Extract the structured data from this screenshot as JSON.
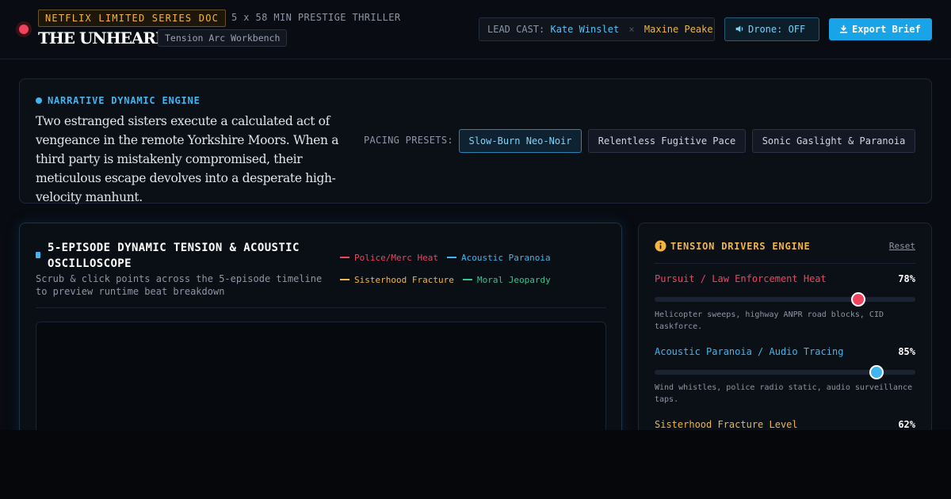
{
  "header": {
    "series_badge": "NETFLIX LIMITED SERIES DOC",
    "series_meta": "5 x 58 MIN PRESTIGE THRILLER",
    "title": "THE UNHEARD",
    "workbench_tag": "Tension Arc Workbench",
    "lead_cast_label": "LEAD CAST:",
    "lead_cast_1": "Kate Winslet",
    "lead_cast_sep": "×",
    "lead_cast_2": "Maxine Peake",
    "drone_label": "Drone: OFF",
    "export_label": "Export Brief"
  },
  "narrative": {
    "label": "NARRATIVE DYNAMIC ENGINE",
    "synopsis": "Two estranged sisters execute a calculated act of vengeance in the remote Yorkshire Moors. When a third party is mistakenly compromised, their meticulous escape devolves into a desperate high-velocity manhunt.",
    "presets_label": "PACING PRESETS:",
    "presets": [
      {
        "label": "Slow-Burn Neo-Noir",
        "active": true
      },
      {
        "label": "Relentless Fugitive Pace",
        "active": false
      },
      {
        "label": "Sonic Gaslight & Paranoia",
        "active": false
      }
    ]
  },
  "oscilloscope": {
    "title": "5-EPISODE DYNAMIC TENSION & ACOUSTIC OSCILLOSCOPE",
    "subtitle": "Scrub & click points across the 5-episode timeline to preview runtime beat breakdown",
    "legend": [
      {
        "label": "Police/Merc Heat",
        "color": "#f0445e"
      },
      {
        "label": "Acoustic Paranoia",
        "color": "#3fb6ef"
      },
      {
        "label": "Sisterhood Fracture",
        "color": "#f2b640"
      },
      {
        "label": "Moral Jeopardy",
        "color": "#2ec98a"
      }
    ]
  },
  "drivers": {
    "title": "TENSION DRIVERS ENGINE",
    "reset_label": "Reset",
    "items": [
      {
        "name": "Pursuit / Law Enforcement Heat",
        "value_label": "78%",
        "value": 78,
        "color": "#f0445e",
        "desc": "Helicopter sweeps, highway ANPR road blocks, CID taskforce."
      },
      {
        "name": "Acoustic Paranoia / Audio Tracing",
        "value_label": "85%",
        "value": 85,
        "color": "#3fb6ef",
        "desc": "Wind whistles, police radio static, audio surveillance taps."
      },
      {
        "name": "Sisterhood Fracture Level",
        "value_label": "62%",
        "value": 62,
        "color": "#f2b640",
        "desc": ""
      }
    ]
  },
  "colors": {
    "accent_blue": "#18a4e6",
    "accent_gold": "#f2b640",
    "accent_red": "#f0445e",
    "accent_green": "#2ec98a"
  }
}
